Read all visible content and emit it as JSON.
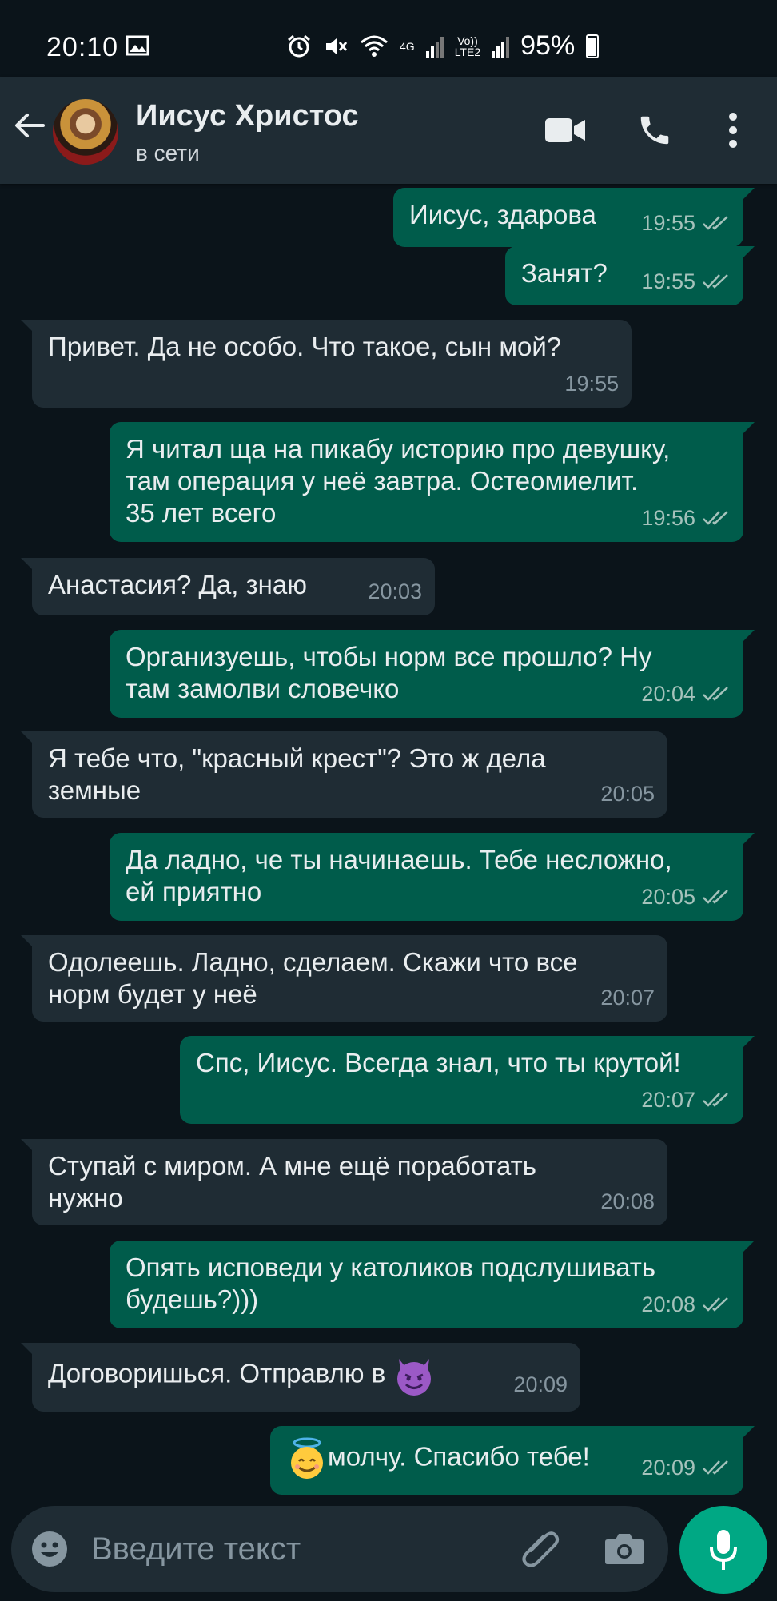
{
  "status_bar": {
    "time": "20:10",
    "battery": "95%",
    "network_1": "4G",
    "network_2_top": "Vo))",
    "network_2_bottom": "LTE2"
  },
  "header": {
    "contact_name": "Иисус Христос",
    "contact_status": "в сети"
  },
  "messages": [
    {
      "dir": "out",
      "text": "Иисус, здарова",
      "time": "19:55"
    },
    {
      "dir": "out",
      "text": "Занят?",
      "time": "19:55"
    },
    {
      "dir": "in",
      "text": "Привет. Да не особо. Что такое, сын мой?",
      "time": "19:55"
    },
    {
      "dir": "out",
      "line1": "Я читал ща на пикабу историю про девушку,",
      "line2": "там операция у неё завтра. Остеомиелит.",
      "line3": "35 лет всего",
      "time": "19:56"
    },
    {
      "dir": "in",
      "text": "Анастасия? Да, знаю",
      "time": "20:03"
    },
    {
      "dir": "out",
      "line1": "Организуешь, чтобы норм все прошло? Ну",
      "line2": "там замолви словечко",
      "time": "20:04"
    },
    {
      "dir": "in",
      "line1": "Я тебе что, \"красный крест\"? Это ж дела",
      "line2": "земные",
      "time": "20:05"
    },
    {
      "dir": "out",
      "line1": "Да ладно, че ты начинаешь. Тебе несложно,",
      "line2": "ей приятно",
      "time": "20:05"
    },
    {
      "dir": "in",
      "line1": "Одолеешь. Ладно, сделаем. Скажи что все",
      "line2": "норм будет у неё",
      "time": "20:07"
    },
    {
      "dir": "out",
      "text": "Спс, Иисус. Всегда знал, что ты крутой!",
      "time": "20:07"
    },
    {
      "dir": "in",
      "line1": "Ступай с миром. А мне ещё поработать",
      "line2": "нужно",
      "time": "20:08"
    },
    {
      "dir": "out",
      "line1": "Опять исповеди у католиков подслушивать",
      "line2": "будешь?)))",
      "time": "20:08"
    },
    {
      "dir": "in",
      "text": "Договоришься. Отправлю в",
      "emoji": "smiling-devil",
      "time": "20:09"
    },
    {
      "dir": "out",
      "text": "молчу. Спасибо тебе!",
      "emoji": "smiling-halo",
      "time": "20:09"
    }
  ],
  "input": {
    "placeholder": "Введите текст"
  },
  "colors": {
    "background": "#0b141a",
    "header": "#1f2c34",
    "outgoing_bubble": "#005c4b",
    "incoming_bubble": "#1f2c34",
    "accent": "#00a884",
    "read_ticks": "#a5c2bb"
  },
  "icons": [
    "back-arrow-icon",
    "video-call-icon",
    "phone-icon",
    "more-vert-icon",
    "emoji-icon",
    "attach-icon",
    "camera-icon",
    "mic-icon"
  ]
}
